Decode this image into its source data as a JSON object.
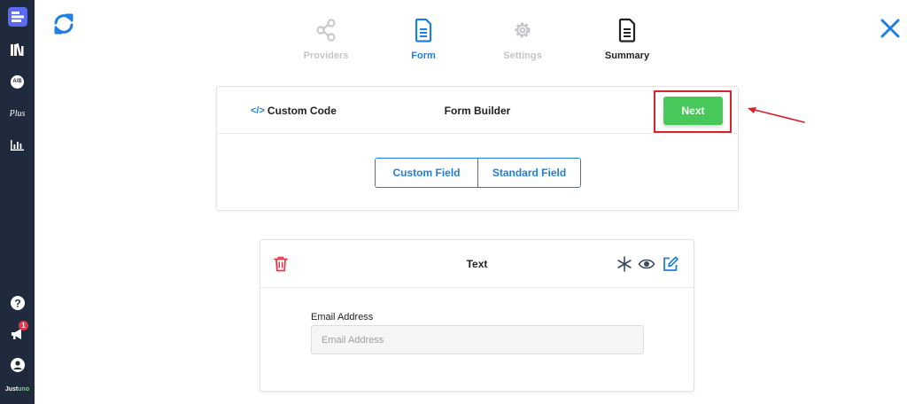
{
  "sidebar": {
    "items": [
      {
        "icon": "forms-icon"
      },
      {
        "icon": "library-icon"
      },
      {
        "icon": "ab-test-icon",
        "text": "A/B"
      },
      {
        "icon": "plus-icon",
        "text": "Plus"
      },
      {
        "icon": "analytics-icon"
      }
    ],
    "bottom": [
      {
        "icon": "help-icon"
      },
      {
        "icon": "announcements-icon",
        "badge": "1"
      },
      {
        "icon": "account-icon"
      }
    ],
    "brand": {
      "part1": "Just",
      "part2": "uno"
    }
  },
  "steps": [
    {
      "label": "Providers",
      "icon": "share-icon",
      "state": "disabled"
    },
    {
      "label": "Form",
      "icon": "document-icon",
      "state": "active"
    },
    {
      "label": "Settings",
      "icon": "gear-icon",
      "state": "disabled"
    },
    {
      "label": "Summary",
      "icon": "document-icon",
      "state": "done"
    }
  ],
  "builder": {
    "custom_code": "Custom Code",
    "code_icon_text": "</>",
    "title": "Form Builder",
    "next_label": "Next",
    "segments": [
      "Custom Field",
      "Standard Field"
    ]
  },
  "field_card": {
    "type": "Text",
    "label": "Email Address",
    "placeholder": "Email Address",
    "value": ""
  },
  "colors": {
    "sidebar_bg": "#1f2a3c",
    "accent": "#1f7fe0",
    "success": "#48c85a",
    "danger": "#e2394a",
    "annotation": "#d8232a"
  }
}
